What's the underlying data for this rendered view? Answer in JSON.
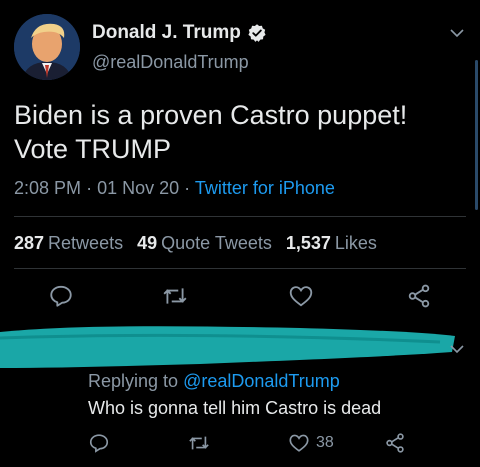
{
  "tweet": {
    "display_name": "Donald J. Trump",
    "handle": "@realDonaldTrump",
    "text_line1": "Biden is a proven Castro puppet!",
    "text_line2": "Vote TRUMP",
    "time": "2:08 PM",
    "date": "01 Nov 20",
    "source": "Twitter for iPhone",
    "stats": {
      "retweets_count": "287",
      "retweets_label": "Retweets",
      "quotes_count": "49",
      "quotes_label": "Quote Tweets",
      "likes_count": "1,537",
      "likes_label": "Likes"
    }
  },
  "reply": {
    "replying_prefix": "Replying to",
    "replying_mention": "@realDonaldTrump",
    "text": "Who is gonna tell him Castro is dead",
    "likes_count": "38"
  },
  "colors": {
    "background": "#000000",
    "text": "#e7e9ea",
    "secondary": "#8b98a5",
    "link": "#1d9bf0",
    "redaction": "#1aa7a7"
  },
  "icons": [
    "verified-badge-icon",
    "chevron-down-icon",
    "reply-icon",
    "retweet-icon",
    "like-icon",
    "share-icon"
  ]
}
